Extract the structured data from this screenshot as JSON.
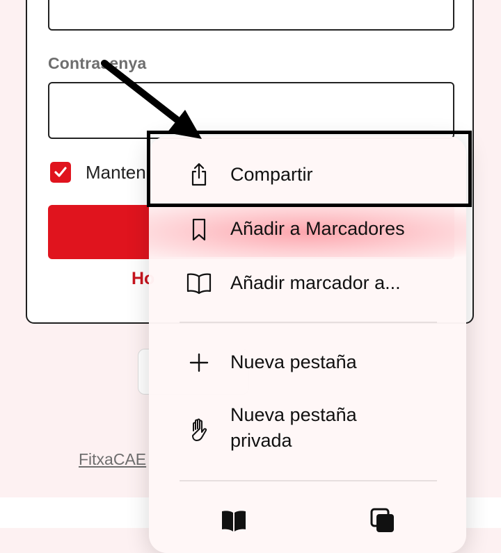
{
  "login": {
    "password_label": "Contrasenya",
    "remember_label": "Manten",
    "forgot_link": "Ho",
    "footer_link": "FitxaCAE"
  },
  "menu": {
    "share_label": "Compartir",
    "add_bookmarks_label": "Añadir a Marcadores",
    "add_bookmark_to_label": "Añadir marcador a...",
    "new_tab_label": "Nueva pestaña",
    "new_private_tab_label_line1": "Nueva pestaña",
    "new_private_tab_label_line2": "privada"
  },
  "icons": {
    "share": "share-icon",
    "bookmark": "bookmark-icon",
    "book": "book-open-icon",
    "plus": "plus-icon",
    "hand": "hand-icon",
    "toolbar_book": "book-icon",
    "toolbar_tabs": "tabs-icon"
  },
  "colors": {
    "accent": "#e0141e",
    "highlight": "#fc8c96",
    "annotation": "#000000"
  }
}
